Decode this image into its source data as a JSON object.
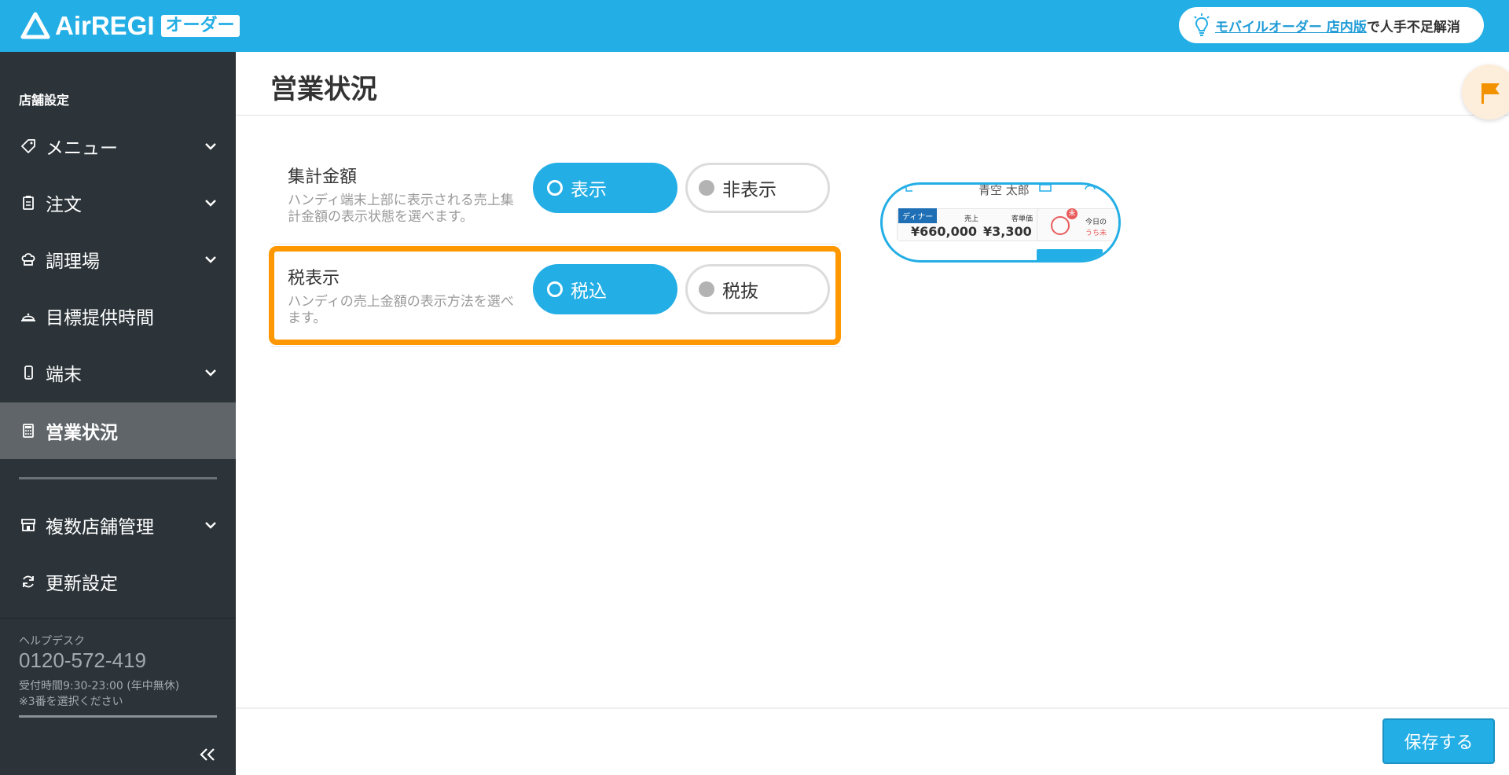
{
  "header": {
    "logo_text": "AirREGI",
    "logo_badge": "オーダー",
    "promo_link": "モバイルオーダー 店内版",
    "promo_text": "で人手不足解消"
  },
  "sidebar": {
    "heading": "店舗設定",
    "items": [
      {
        "label": "メニュー",
        "icon": "tag-icon",
        "has_submenu": true
      },
      {
        "label": "注文",
        "icon": "clipboard-icon",
        "has_submenu": true
      },
      {
        "label": "調理場",
        "icon": "chef-hat-icon",
        "has_submenu": true
      },
      {
        "label": "目標提供時間",
        "icon": "cloche-icon",
        "has_submenu": false
      },
      {
        "label": "端末",
        "icon": "smartphone-icon",
        "has_submenu": true
      },
      {
        "label": "営業状況",
        "icon": "calculator-icon",
        "has_submenu": false,
        "active": true
      },
      {
        "label": "複数店舗管理",
        "icon": "store-icon",
        "has_submenu": true
      },
      {
        "label": "更新設定",
        "icon": "refresh-icon",
        "has_submenu": false
      }
    ],
    "help": {
      "label": "ヘルプデスク",
      "phone": "0120-572-419",
      "hours": "受付時間9:30-23:00 (年中無休)",
      "note": "※3番を選択ください"
    }
  },
  "main": {
    "title": "営業状況",
    "settings": [
      {
        "label": "集計金額",
        "description": "ハンディ端末上部に表示される売上集計金額の表示状態を選べます。",
        "options": [
          "表示",
          "非表示"
        ],
        "selected": "表示"
      },
      {
        "label": "税表示",
        "description": "ハンディの売上金額の表示方法を選べます。",
        "options": [
          "税込",
          "税抜"
        ],
        "selected": "税込"
      }
    ],
    "preview": {
      "name": "青空 太郎",
      "tag": "ディナー",
      "sales_label": "売上",
      "sales_value": "¥660,000",
      "avg_label": "客単価",
      "avg_value": "¥3,300",
      "badge": "未",
      "today_label": "今日の",
      "today_sub": "うち未"
    },
    "save_label": "保存する"
  },
  "colors": {
    "accent": "#23aee5",
    "sidebar_bg": "#2c3439",
    "sidebar_active": "#5f6569",
    "highlight": "#ff9700"
  }
}
